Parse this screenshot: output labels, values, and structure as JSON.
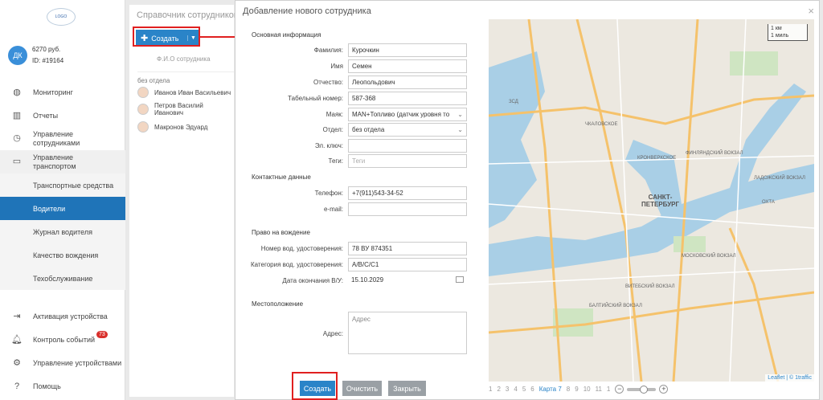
{
  "sidebar": {
    "logo_text": "LOGO",
    "user": {
      "initials": "ДК",
      "balance": "6270 руб.",
      "id": "ID: #19164"
    },
    "nav": [
      {
        "label": "Мониторинг",
        "icon": "globe-icon"
      },
      {
        "label": "Отчеты",
        "icon": "chart-icon"
      },
      {
        "label": "Управление сотрудниками",
        "icon": "clock-icon"
      },
      {
        "label": "Управление транспортом",
        "icon": "car-icon"
      }
    ],
    "subnav": [
      "Транспортные средства",
      "Водители",
      "Журнал водителя",
      "Качество вождения",
      "Техобслуживание"
    ],
    "bottom": [
      {
        "label": "Активация устройства",
        "icon": "login-icon"
      },
      {
        "label": "Контроль событий",
        "icon": "bell-icon",
        "badge": "73"
      },
      {
        "label": "Управление устройствами",
        "icon": "gear-icon"
      },
      {
        "label": "Помощь",
        "icon": "help-icon"
      }
    ]
  },
  "directory": {
    "title": "Справочник сотрудников",
    "create_label": "Создать",
    "column": "Ф.И.О сотрудника",
    "group": "без отдела",
    "rows": [
      "Иванов Иван Васильевич",
      "Петров Василий Иванович",
      "Макронов Эдуард"
    ]
  },
  "modal": {
    "title": "Добавление нового сотрудника",
    "sections": {
      "basic": "Основная информация",
      "contact": "Контактные данные",
      "driving": "Право на вождение",
      "location": "Местоположение"
    },
    "fields": {
      "lastname": {
        "label": "Фамилия:",
        "value": "Курочкин"
      },
      "firstname": {
        "label": "Имя",
        "value": "Семен"
      },
      "patronymic": {
        "label": "Отчество:",
        "value": "Леопольдович"
      },
      "tabnum": {
        "label": "Табельный номер:",
        "value": "587-368"
      },
      "beacon": {
        "label": "Маяк:",
        "value": "MAN+Топливо (датчик уровня то"
      },
      "dept": {
        "label": "Отдел:",
        "value": "без отдела"
      },
      "key": {
        "label": "Эл. ключ:",
        "value": ""
      },
      "tags": {
        "label": "Теги:",
        "placeholder": "Теги"
      },
      "phone": {
        "label": "Телефон:",
        "value": "+7(911)543-34-52"
      },
      "email": {
        "label": "e-mail:",
        "value": ""
      },
      "license": {
        "label": "Номер вод. удостоверения:",
        "value": "78 ВУ 874351"
      },
      "category": {
        "label": "Категория вод. удостоверения:",
        "value": "A/B/C/C1"
      },
      "expiry": {
        "label": "Дата окончания В/У:",
        "value": "15.10.2029"
      },
      "address": {
        "label": "Адрес:",
        "placeholder": "Адрес"
      }
    },
    "buttons": {
      "create": "Создать",
      "clear": "Очистить",
      "close": "Закрыть"
    }
  },
  "map": {
    "scale_km": "1 км",
    "scale_mi": "1 миль",
    "labels": [
      "САНКТ-",
      "ПЕТЕРБУРГ",
      "ФИНЛЯНДСКИЙ ВОКЗАЛ",
      "МОСКОВСКИЙ ВОКЗАЛ",
      "ВИТЕБСКИЙ ВОКЗАЛ",
      "ЛАДОЖСКИЙ ВОКЗАЛ",
      "БАЛТИЙСКИЙ ВОКЗАЛ",
      "ЧКАЛОВСКОЕ",
      "КРОНВЕРКСКОЕ",
      "ОХТА",
      "ЗСД"
    ],
    "attribution": "Leaflet | © 1traffic",
    "pager": [
      "1",
      "2",
      "3",
      "4",
      "5",
      "6",
      "Карта 7",
      "8",
      "9",
      "10",
      "11",
      "1"
    ]
  }
}
